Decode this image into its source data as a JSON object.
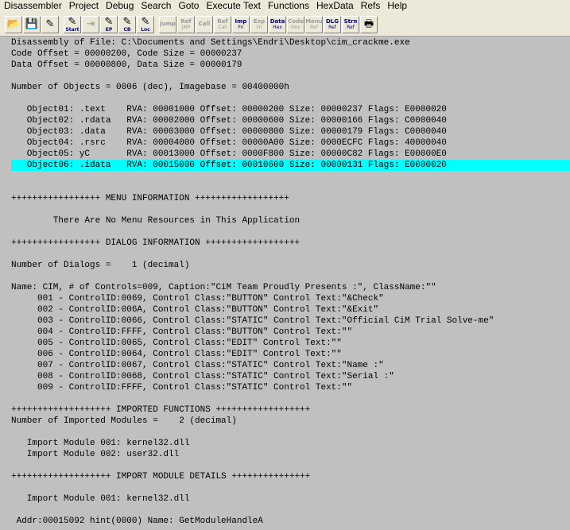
{
  "menu": [
    "Disassembler",
    "Project",
    "Debug",
    "Search",
    "Goto",
    "Execute Text",
    "Functions",
    "HexData",
    "Refs",
    "Help"
  ],
  "toolbar": [
    {
      "name": "open-file-icon",
      "glyph": "📂",
      "enabled": true
    },
    {
      "name": "save-file-icon",
      "glyph": "💾",
      "enabled": true
    },
    {
      "name": "load-process-icon",
      "glyph": "✎",
      "enabled": true
    },
    {
      "name": "debug-start-icon",
      "glyph": "✎",
      "hint": "Start",
      "enabled": true
    },
    {
      "name": "debug-step-icon",
      "glyph": "⇥",
      "enabled": false
    },
    {
      "name": "debug-ep-icon",
      "glyph": "✎",
      "hint": "EP",
      "enabled": true
    },
    {
      "name": "debug-cb-icon",
      "glyph": "✎",
      "hint": "CB",
      "enabled": true
    },
    {
      "name": "debug-loc-icon",
      "glyph": "✎",
      "hint": "Loc",
      "enabled": true
    },
    {
      "name": "jump-icon",
      "t1": "Jump",
      "t2": "",
      "enabled": false
    },
    {
      "name": "ref-jump-icon",
      "t1": "Ref",
      "t2": "JMP",
      "enabled": false
    },
    {
      "name": "call-icon",
      "t1": "Call",
      "t2": "",
      "enabled": false
    },
    {
      "name": "ref-call-icon",
      "t1": "Ref",
      "t2": "Call",
      "enabled": false
    },
    {
      "name": "imp-fn-icon",
      "t1": "Imp",
      "t2": "Fn",
      "enabled": true
    },
    {
      "name": "exp-fn-icon",
      "t1": "Exp",
      "t2": "Fn",
      "enabled": false
    },
    {
      "name": "data-hex-icon",
      "t1": "Data",
      "t2": "Hex",
      "enabled": true
    },
    {
      "name": "code-hex-icon",
      "t1": "Code",
      "t2": "Hex",
      "enabled": false
    },
    {
      "name": "menu-ref-icon",
      "t1": "Menu",
      "t2": "Ref",
      "enabled": false
    },
    {
      "name": "dlg-ref-icon",
      "t1": "DLG",
      "t2": "Ref",
      "enabled": true
    },
    {
      "name": "strn-ref-icon",
      "t1": "Strn",
      "t2": "Ref",
      "enabled": true
    },
    {
      "name": "print-icon",
      "glyph": "🖶",
      "enabled": true
    }
  ],
  "lines": [
    "Disassembly of File: C:\\Documents and Settings\\Endri\\Desktop\\cim_crackme.exe",
    "Code Offset = 00000200, Code Size = 00000237",
    "Data Offset = 00000800, Data Size = 00000179",
    "",
    "Number of Objects = 0006 (dec), Imagebase = 00400000h",
    "",
    "   Object01: .text    RVA: 00001000 Offset: 00000200 Size: 00000237 Flags: E0000020",
    "   Object02: .rdata   RVA: 00002000 Offset: 00000600 Size: 00000166 Flags: C0000040",
    "   Object03: .data    RVA: 00003000 Offset: 00000800 Size: 00000179 Flags: C0000040",
    "   Object04: .rsrc    RVA: 00004000 Offset: 00000A00 Size: 0000ECFC Flags: 40000040",
    "   Object05: yC       RVA: 00013000 Offset: 0000F800 Size: 00000C82 Flags: E00000E0",
    "   Object06: .idata   RVA: 00015000 Offset: 00010600 Size: 00000131 Flags: E0000020",
    "",
    "",
    "+++++++++++++++++ MENU INFORMATION ++++++++++++++++++",
    "",
    "        There Are No Menu Resources in This Application",
    "",
    "+++++++++++++++++ DIALOG INFORMATION ++++++++++++++++++",
    "",
    "Number of Dialogs =    1 (decimal)",
    "",
    "Name: CIM, # of Controls=009, Caption:\"CiM Team Proudly Presents :\", ClassName:\"\"",
    "     001 - ControlID:0069, Control Class:\"BUTTON\" Control Text:\"&Check\"",
    "     002 - ControlID:006A, Control Class:\"BUTTON\" Control Text:\"&Exit\"",
    "     003 - ControlID:0066, Control Class:\"STATIC\" Control Text:\"Official CiM Trial Solve-me\"",
    "     004 - ControlID:FFFF, Control Class:\"BUTTON\" Control Text:\"\"",
    "     005 - ControlID:0065, Control Class:\"EDIT\" Control Text:\"\"",
    "     006 - ControlID:0064, Control Class:\"EDIT\" Control Text:\"\"",
    "     007 - ControlID:0067, Control Class:\"STATIC\" Control Text:\"Name :\"",
    "     008 - ControlID:0068, Control Class:\"STATIC\" Control Text:\"Serial :\"",
    "     009 - ControlID:FFFF, Control Class:\"STATIC\" Control Text:\"\"",
    "",
    "+++++++++++++++++++ IMPORTED FUNCTIONS ++++++++++++++++++",
    "Number of Imported Modules =    2 (decimal)",
    "",
    "   Import Module 001: kernel32.dll",
    "   Import Module 002: user32.dll",
    "",
    "+++++++++++++++++++ IMPORT MODULE DETAILS +++++++++++++++",
    "",
    "   Import Module 001: kernel32.dll",
    "",
    " Addr:00015092 hint(0000) Name: GetModuleHandleA"
  ],
  "selected_line": 11,
  "colors": {
    "background": "#c0c0c0",
    "selection": "#00ffff",
    "menubar": "#ece9d8"
  }
}
